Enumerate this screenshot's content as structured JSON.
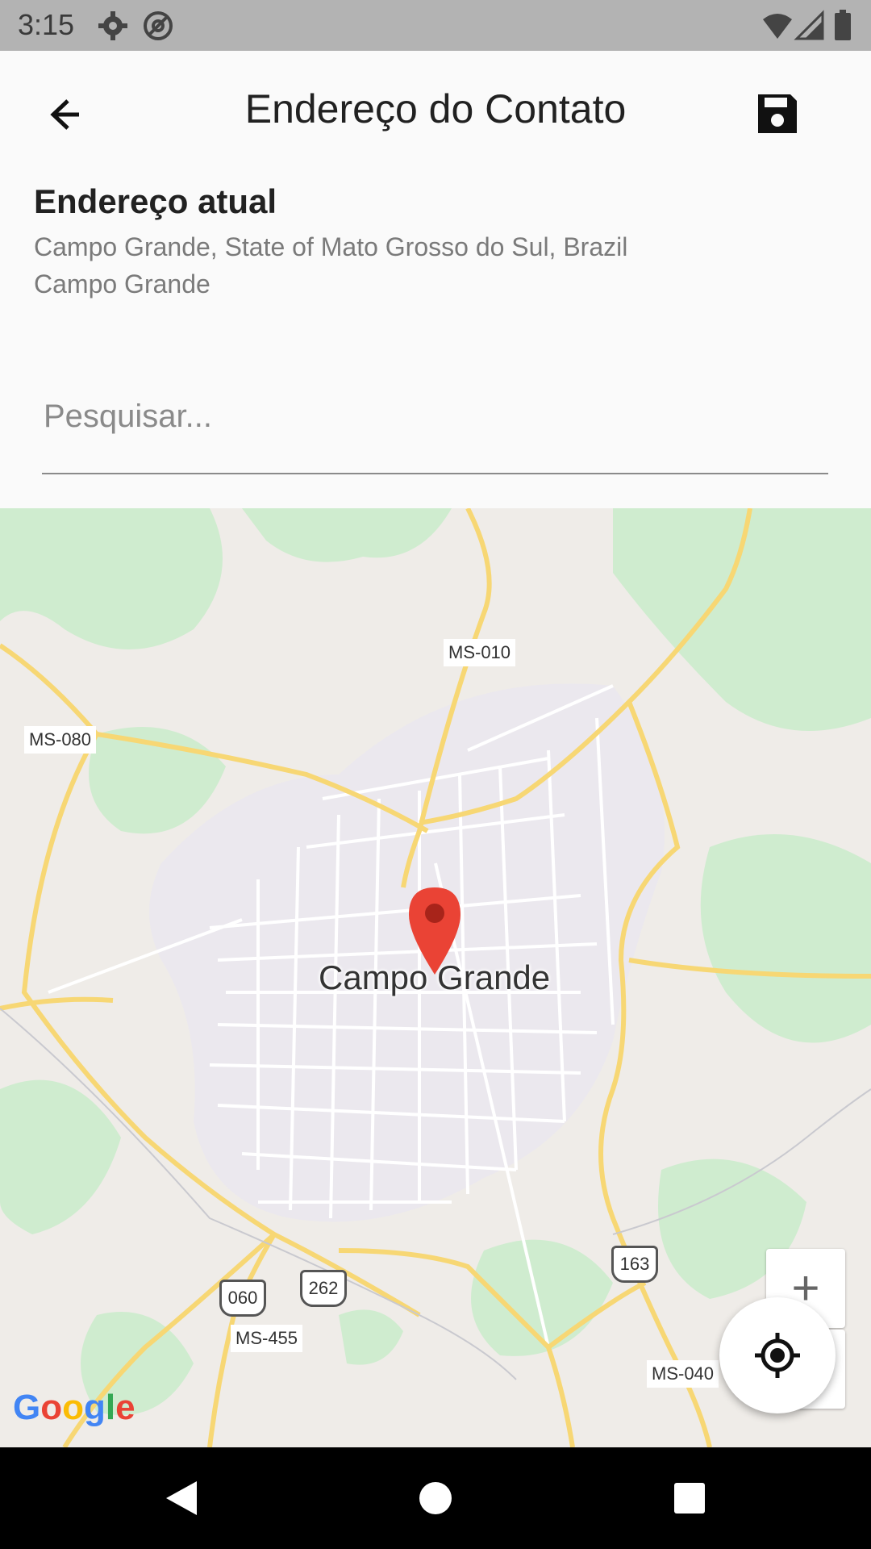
{
  "status_bar": {
    "time": "3:15",
    "icons": [
      "gear-icon",
      "at-sign-icon",
      "wifi-icon",
      "signal-icon",
      "battery-icon"
    ]
  },
  "app_bar": {
    "title": "Endereço do Contato",
    "back_icon": "arrow-left-icon",
    "save_icon": "floppy-disk-icon"
  },
  "address": {
    "heading": "Endereço atual",
    "line1": "Campo Grande, State of Mato Grosso do Sul, Brazil",
    "line2": "Campo Grande"
  },
  "search": {
    "placeholder": "Pesquisar...",
    "value": ""
  },
  "map": {
    "city_label": "Campo Grande",
    "road_labels": [
      "MS-010",
      "MS-080",
      "MS-455",
      "MS-040"
    ],
    "route_shields": [
      "060",
      "262",
      "163"
    ],
    "zoom_in_label": "+",
    "attribution": "Google",
    "colors": {
      "land": "#efece8",
      "park": "#cfeccf",
      "urban": "#ebe8ee",
      "highway": "#f7d774",
      "road": "#ffffff",
      "pin": "#ea4335"
    }
  },
  "fab": {
    "icon": "my-location-icon"
  },
  "nav_bar": {
    "icons": [
      "back-triangle-icon",
      "home-circle-icon",
      "recents-square-icon"
    ]
  }
}
